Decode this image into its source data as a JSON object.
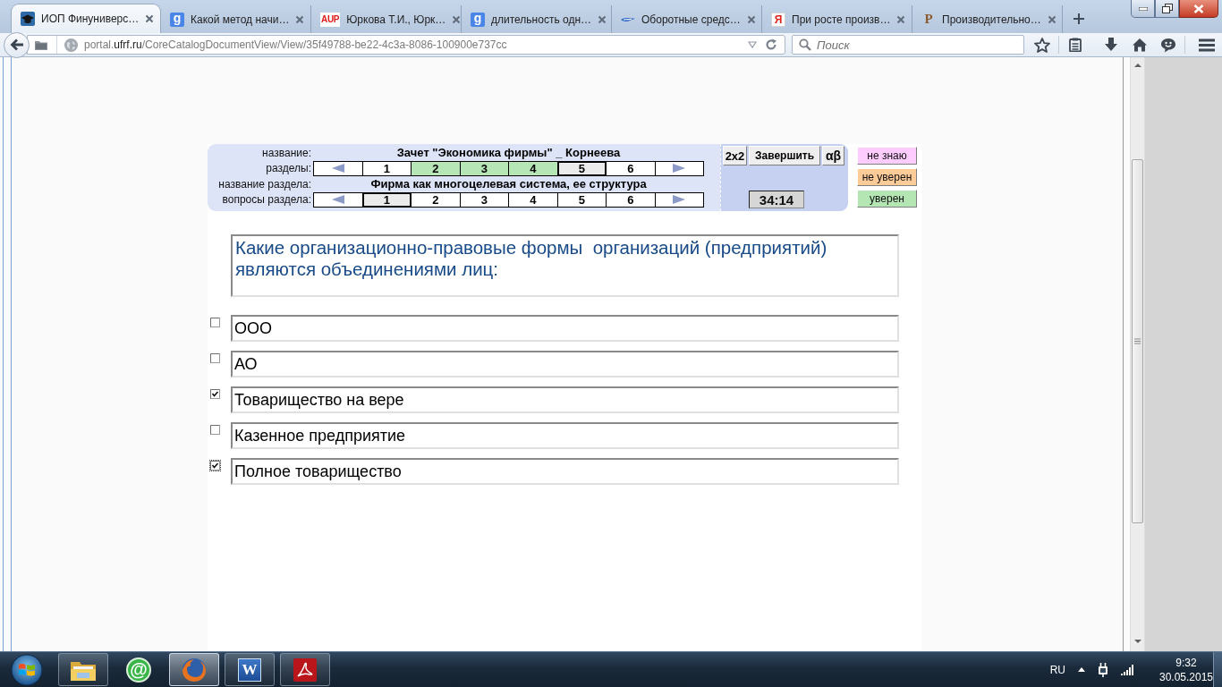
{
  "browser": {
    "tabs": [
      {
        "title": "ИОП Финуниверс…",
        "icon": {
          "kind": "cap"
        },
        "selected": true
      },
      {
        "title": "Какой метод начи…",
        "icon": {
          "kind": "google",
          "glyph": "g"
        },
        "selected": false
      },
      {
        "title": "Юркова Т.И., Юрк…",
        "icon": {
          "kind": "aup",
          "glyph": "AUP"
        },
        "selected": false
      },
      {
        "title": "длительность одн…",
        "icon": {
          "kind": "google",
          "glyph": "g"
        },
        "selected": false
      },
      {
        "title": "Оборотные средс…",
        "icon": {
          "kind": "pen"
        },
        "selected": false
      },
      {
        "title": "При росте произв…",
        "icon": {
          "kind": "yandex",
          "glyph": "Я"
        },
        "selected": false
      },
      {
        "title": "Производительно…",
        "icon": {
          "kind": "p-logo",
          "glyph": "P"
        },
        "selected": false
      }
    ],
    "address": {
      "parts": [
        {
          "text": "portal.",
          "highlight": false
        },
        {
          "text": "ufrf.ru",
          "highlight": true
        },
        {
          "text": "/CoreCatalogDocumentView/View/35f49788-be22-4c3a-8086-100900e737cc",
          "highlight": false
        }
      ]
    },
    "search": {
      "placeholder": "Поиск"
    }
  },
  "test": {
    "name_label": "название:",
    "name": "Зачет \"Экономика фирмы\" _ Корнеева",
    "sections_label": "разделы:",
    "sections": [
      {
        "label": "1",
        "answered": false,
        "selected": false
      },
      {
        "label": "2",
        "answered": true,
        "selected": false
      },
      {
        "label": "3",
        "answered": true,
        "selected": false
      },
      {
        "label": "4",
        "answered": true,
        "selected": false
      },
      {
        "label": "5",
        "answered": false,
        "selected": true
      },
      {
        "label": "6",
        "answered": false,
        "selected": false
      }
    ],
    "section_title_label": "название раздела:",
    "section_title": "Фирма как многоцелевая система, ее структура",
    "questions_label": "вопросы раздела:",
    "questions": [
      {
        "label": "1",
        "answered": false,
        "selected": true
      },
      {
        "label": "2",
        "answered": false,
        "selected": false
      },
      {
        "label": "3",
        "answered": false,
        "selected": false
      },
      {
        "label": "4",
        "answered": false,
        "selected": false
      },
      {
        "label": "5",
        "answered": false,
        "selected": false
      },
      {
        "label": "6",
        "answered": false,
        "selected": false
      }
    ],
    "buttons": [
      "2x2",
      "Завершить",
      "αβ"
    ],
    "timer": "34:14"
  },
  "confidence_buttons": [
    {
      "label": "не знаю",
      "color": "#ffccff"
    },
    {
      "label": "не уверен",
      "color": "#ffcc99"
    },
    {
      "label": "уверен",
      "color": "#b3e6b3"
    }
  ],
  "question": {
    "text": "Какие организационно-правовые формы  организаций (предприятий) являются объединениями лиц:"
  },
  "answers": [
    {
      "text": "ООО",
      "checked": false,
      "focused": false
    },
    {
      "text": "АО",
      "checked": false,
      "focused": false
    },
    {
      "text": "Товарищество на вере",
      "checked": true,
      "focused": false
    },
    {
      "text": "Казенное предприятие",
      "checked": false,
      "focused": false
    },
    {
      "text": "Полное товарищество",
      "checked": true,
      "focused": true
    }
  ],
  "taskbar": {
    "apps": [
      {
        "kind": "explorer",
        "running": true,
        "selected": false
      },
      {
        "kind": "agent",
        "glyph": "@",
        "running": false,
        "selected": false
      },
      {
        "kind": "firefox",
        "running": true,
        "selected": true
      },
      {
        "kind": "word",
        "glyph": "W",
        "running": true,
        "selected": false
      },
      {
        "kind": "pdf",
        "running": true,
        "selected": false
      }
    ],
    "language": "RU",
    "time": "9:32",
    "date": "30.05.2015"
  }
}
